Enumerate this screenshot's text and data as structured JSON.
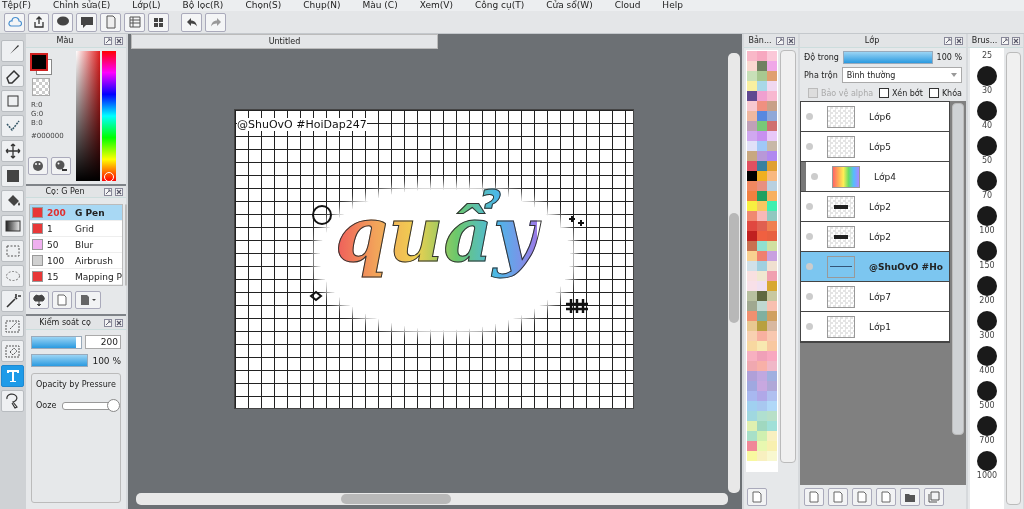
{
  "menu": [
    "Tệp(F)",
    "Chỉnh sửa(E)",
    "Lớp(L)",
    "Bộ lọc(R)",
    "Chọn(S)",
    "Chụp(N)",
    "Màu (C)",
    "Xem(V)",
    "Công cụ(T)",
    "Cửa sổ(W)",
    "Cloud",
    "Help"
  ],
  "toolbar": [
    {
      "kind": "cloud"
    },
    {
      "kind": "share"
    },
    {
      "kind": "bubble"
    },
    {
      "kind": "comment"
    },
    {
      "kind": "page"
    },
    {
      "kind": "list"
    },
    {
      "kind": "grid"
    },
    {
      "kind": "undo"
    },
    {
      "kind": "redo"
    }
  ],
  "tools": [
    {
      "kind": "brush",
      "selected": false
    },
    {
      "kind": "eraser",
      "selected": false
    },
    {
      "kind": "rect",
      "selected": false
    },
    {
      "kind": "dots",
      "selected": false
    },
    {
      "kind": "move",
      "selected": false
    },
    {
      "kind": "fill",
      "selected": false
    },
    {
      "kind": "bucket",
      "selected": false
    },
    {
      "kind": "gradient",
      "selected": false
    },
    {
      "kind": "select",
      "selected": false
    },
    {
      "kind": "lasso",
      "selected": false
    },
    {
      "kind": "wand",
      "selected": false
    },
    {
      "kind": "selpen",
      "selected": false
    },
    {
      "kind": "selerase",
      "selected": false
    },
    {
      "kind": "text",
      "selected": true
    },
    {
      "kind": "pick",
      "selected": false
    }
  ],
  "color_panel": {
    "title": "Màu",
    "r": "R:0",
    "g": "G:0",
    "b": "B:0",
    "hex": "#000000",
    "hue_slider": {
      "level": 0
    }
  },
  "brush_panel": {
    "title": "Cọ: G Pen",
    "brushes": [
      {
        "color": "#e83838",
        "size": "200",
        "name": "G Pen",
        "selected": true
      },
      {
        "color": "#e83838",
        "size": "1",
        "name": "Grid",
        "selected": false
      },
      {
        "color": "#f0b0f0",
        "size": "50",
        "name": "Blur",
        "selected": false
      },
      {
        "color": "#d0d0d0",
        "size": "100",
        "name": "Airbrush",
        "selected": false
      },
      {
        "color": "#e83838",
        "size": "15",
        "name": "Mapping P",
        "selected": false
      }
    ]
  },
  "brush_control": {
    "title": "Kiểm soát cọ",
    "size": "200",
    "size_slider": {
      "level": 0.9
    },
    "opacity": "100 %",
    "opacity_slider": {
      "level": 1
    },
    "group_title": "Opacity by Pressure",
    "ooze_label": "Ooze",
    "ooze_slider": {
      "level": 1
    }
  },
  "document": {
    "tab": "Untitled",
    "watermark": "@ShuOvO #HoiDap247",
    "lettering": "quẩy"
  },
  "palette": {
    "title": "Bản...",
    "rows": [
      [
        {
          "color": "#f9b8c8"
        },
        {
          "color": "#f7a8c0"
        },
        {
          "color": "#fbc8d8"
        }
      ],
      [
        {
          "color": "#fbd8d0"
        },
        {
          "color": "#708060"
        },
        {
          "color": "#f0a8e8"
        }
      ],
      [
        {
          "color": "#c8e0b8"
        },
        {
          "color": "#a8c890"
        },
        {
          "color": "#e0a070"
        }
      ],
      [
        {
          "color": "#f8f0a0"
        },
        {
          "color": "#a8d8e8"
        },
        {
          "color": "#f0d8f0"
        }
      ],
      [
        {
          "color": "#604890"
        },
        {
          "color": "#f0a0d0"
        },
        {
          "color": "#f8b8d0"
        }
      ],
      [
        {
          "color": "#f8c8d0"
        },
        {
          "color": "#f09080"
        },
        {
          "color": "#c8a088"
        }
      ],
      [
        {
          "color": "#f0b8a0"
        },
        {
          "color": "#5888e0"
        },
        {
          "color": "#90a8d8"
        }
      ],
      [
        {
          "color": "#c0a0b8"
        },
        {
          "color": "#78c878"
        },
        {
          "color": "#d07070"
        }
      ],
      [
        {
          "color": "#d0a8f0"
        },
        {
          "color": "#c890f0"
        },
        {
          "color": "#e8c8f8"
        }
      ],
      [
        {
          "color": "#e0e0f8"
        },
        {
          "color": "#a0c8f8"
        },
        {
          "color": "#c8b8a8"
        }
      ],
      [
        {
          "color": "#c8a880"
        },
        {
          "color": "#b898d8"
        },
        {
          "color": "#b088f0"
        }
      ],
      [
        {
          "color": "#e05060"
        },
        {
          "color": "#3880a0"
        },
        {
          "color": "#e0a030"
        }
      ],
      [
        {
          "color": "#000000"
        },
        {
          "color": "#f0b020"
        },
        {
          "color": "#f8b880"
        }
      ],
      [
        {
          "color": "#f08860"
        },
        {
          "color": "#e89080"
        },
        {
          "color": "#b8d0e0"
        }
      ],
      [
        {
          "color": "#f08040"
        },
        {
          "color": "#20a060"
        },
        {
          "color": "#f8b060"
        }
      ],
      [
        {
          "color": "#f8f040"
        },
        {
          "color": "#f8c860"
        },
        {
          "color": "#40f0b0"
        }
      ],
      [
        {
          "color": "#f08870"
        },
        {
          "color": "#f8b8b8"
        },
        {
          "color": "#90c8c0"
        }
      ],
      [
        {
          "color": "#e04840"
        },
        {
          "color": "#e06050"
        },
        {
          "color": "#f08050"
        }
      ],
      [
        {
          "color": "#c02020"
        },
        {
          "color": "#f06040"
        },
        {
          "color": "#e86040"
        }
      ],
      [
        {
          "color": "#c87050"
        },
        {
          "color": "#90e0d0"
        },
        {
          "color": "#d0e0a0"
        }
      ],
      [
        {
          "color": "#f8d090"
        },
        {
          "color": "#f08070"
        },
        {
          "color": "#c8a0e0"
        }
      ],
      [
        {
          "color": "#d0e0e8"
        },
        {
          "color": "#a0d0e0"
        },
        {
          "color": "#f0e0d0"
        }
      ],
      [
        {
          "color": "#f8e0e0"
        },
        {
          "color": "#f0e8d0"
        },
        {
          "color": "#f0a0b0"
        }
      ],
      [
        {
          "color": "#f8e0e8"
        },
        {
          "color": "#f0e0f0"
        },
        {
          "color": "#d8a830"
        }
      ],
      [
        {
          "color": "#b8c0a0"
        },
        {
          "color": "#606840"
        },
        {
          "color": "#c8c8a0"
        }
      ],
      [
        {
          "color": "#a0a890"
        },
        {
          "color": "#c0d8d0"
        },
        {
          "color": "#f8c0b0"
        }
      ],
      [
        {
          "color": "#f09070"
        },
        {
          "color": "#80b0a0"
        },
        {
          "color": "#d0a060"
        }
      ],
      [
        {
          "color": "#e8c890"
        },
        {
          "color": "#b8a040"
        },
        {
          "color": "#d8b8a0"
        }
      ],
      [
        {
          "color": "#f8d0b0"
        },
        {
          "color": "#f8b0a0"
        },
        {
          "color": "#f8c8b0"
        }
      ],
      [
        {
          "color": "#f8d8a0"
        },
        {
          "color": "#f8e8b0"
        },
        {
          "color": "#f8c8a0"
        }
      ],
      [
        {
          "color": "#f8b0c0"
        },
        {
          "color": "#f0a0b8"
        },
        {
          "color": "#f8a8c0"
        }
      ],
      [
        {
          "color": "#f0a8b0"
        },
        {
          "color": "#f8b0a8"
        },
        {
          "color": "#f0b8c8"
        }
      ],
      [
        {
          "color": "#b0a0d8"
        },
        {
          "color": "#c0a8e0"
        },
        {
          "color": "#a0b0e0"
        }
      ],
      [
        {
          "color": "#a0a8e0"
        },
        {
          "color": "#c8a8e0"
        },
        {
          "color": "#b0a8d8"
        }
      ],
      [
        {
          "color": "#a8b8f0"
        },
        {
          "color": "#b0a8e8"
        },
        {
          "color": "#b0c0f0"
        }
      ],
      [
        {
          "color": "#a0d0f0"
        },
        {
          "color": "#a8c8f0"
        },
        {
          "color": "#b0d8f8"
        }
      ],
      [
        {
          "color": "#a0d8e0"
        },
        {
          "color": "#b0e0d0"
        },
        {
          "color": "#b8e0c8"
        }
      ],
      [
        {
          "color": "#e0f0b0"
        },
        {
          "color": "#a0d8c0"
        },
        {
          "color": "#a0e0d8"
        }
      ],
      [
        {
          "color": "#a8e0c8"
        },
        {
          "color": "#d0f0b0"
        },
        {
          "color": "#f8f0c0"
        }
      ],
      [
        {
          "color": "#f08898"
        },
        {
          "color": "#e8f8b0"
        },
        {
          "color": "#f8f0b0"
        }
      ],
      [
        {
          "color": "#f8f8a0"
        },
        {
          "color": "#f8f0c0"
        },
        {
          "color": "#f8f8d0"
        }
      ]
    ]
  },
  "layer_panel": {
    "title": "Lớp",
    "opacity_label": "Độ trong",
    "opacity_slider": {
      "level": 1
    },
    "opacity": "100 %",
    "blend_label": "Pha trộn",
    "blend": "Bình thường",
    "protect_alpha": {
      "label": "Bảo vệ alpha",
      "checked": false,
      "disabled": true
    },
    "clip": {
      "label": "Xén bớt",
      "checked": false,
      "disabled": false
    },
    "lock": {
      "label": "Khóa",
      "checked": false,
      "disabled": false
    },
    "layers": [
      {
        "name": "Lớp6",
        "kind": "blank",
        "clipped": false,
        "selected": false
      },
      {
        "name": "Lớp5",
        "kind": "blank",
        "clipped": false,
        "selected": false
      },
      {
        "name": "Lớp4",
        "kind": "rainbow",
        "clipped": true,
        "selected": false
      },
      {
        "name": "Lớp2",
        "kind": "text",
        "clipped": false,
        "selected": false
      },
      {
        "name": "Lớp2",
        "kind": "text",
        "clipped": false,
        "selected": false
      },
      {
        "name": "@ShuOvO #Ho",
        "kind": "line",
        "clipped": false,
        "selected": true
      },
      {
        "name": "Lớp7",
        "kind": "blank",
        "clipped": false,
        "selected": false
      },
      {
        "name": "Lớp1",
        "kind": "blank",
        "clipped": false,
        "selected": false
      }
    ]
  },
  "brush_sizes": {
    "title": "Brus...",
    "sizes": [
      "25",
      "30",
      "40",
      "50",
      "70",
      "100",
      "150",
      "200",
      "300",
      "400",
      "500",
      "700",
      "1000"
    ]
  }
}
